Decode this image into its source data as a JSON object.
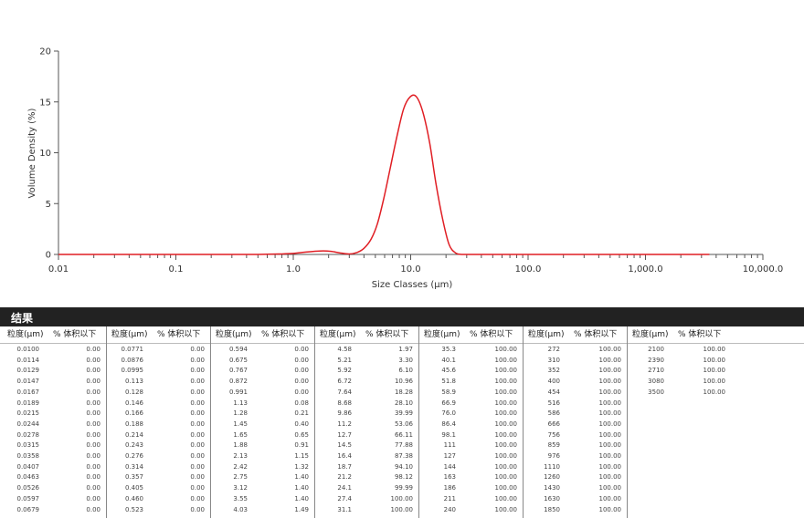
{
  "chart_data": {
    "type": "line",
    "xscale": "log",
    "xlim": [
      0.01,
      10000
    ],
    "ylim": [
      0,
      20
    ],
    "xlabel": "Size Classes (μm)",
    "ylabel": "Volume Density (%)",
    "xticks": [
      "0.01",
      "0.1",
      "1.0",
      "10.0",
      "100.0",
      "1,000.0",
      "10,000.0"
    ],
    "yticks": [
      "0",
      "5",
      "10",
      "15",
      "20"
    ],
    "color": "#e01e24",
    "series": [
      {
        "x": [
          0.01,
          0.05,
          0.2,
          0.5,
          0.8,
          1.0,
          1.2,
          1.5,
          1.8,
          2.1,
          2.5,
          3.0,
          3.5,
          4.0,
          4.6,
          5.2,
          5.9,
          6.7,
          7.6,
          8.7,
          9.9,
          11.2,
          12.7,
          14.5,
          16.4,
          18.7,
          21.2,
          24.1,
          27.4,
          31.1,
          50,
          100,
          1000,
          3500
        ],
        "y": [
          0,
          0,
          0,
          0,
          0.05,
          0.1,
          0.2,
          0.3,
          0.35,
          0.3,
          0.15,
          0.05,
          0.2,
          0.6,
          1.5,
          3.0,
          5.5,
          8.5,
          11.5,
          14.3,
          15.5,
          15.5,
          14.0,
          11.0,
          7.0,
          3.5,
          1.0,
          0.15,
          0,
          0,
          0,
          0,
          0,
          0
        ]
      }
    ]
  },
  "results": {
    "title": "结果",
    "col_size": "粒度(μm)",
    "col_vol": "% 体积以下",
    "groups": [
      {
        "sizes": [
          "0.0100",
          "0.0114",
          "0.0129",
          "0.0147",
          "0.0167",
          "0.0189",
          "0.0215",
          "0.0244",
          "0.0278",
          "0.0315",
          "0.0358",
          "0.0407",
          "0.0463",
          "0.0526",
          "0.0597",
          "0.0679"
        ],
        "vols": [
          "0.00",
          "0.00",
          "0.00",
          "0.00",
          "0.00",
          "0.00",
          "0.00",
          "0.00",
          "0.00",
          "0.00",
          "0.00",
          "0.00",
          "0.00",
          "0.00",
          "0.00",
          "0.00"
        ]
      },
      {
        "sizes": [
          "0.0771",
          "0.0876",
          "0.0995",
          "0.113",
          "0.128",
          "0.146",
          "0.166",
          "0.188",
          "0.214",
          "0.243",
          "0.276",
          "0.314",
          "0.357",
          "0.405",
          "0.460",
          "0.523"
        ],
        "vols": [
          "0.00",
          "0.00",
          "0.00",
          "0.00",
          "0.00",
          "0.00",
          "0.00",
          "0.00",
          "0.00",
          "0.00",
          "0.00",
          "0.00",
          "0.00",
          "0.00",
          "0.00",
          "0.00"
        ]
      },
      {
        "sizes": [
          "0.594",
          "0.675",
          "0.767",
          "0.872",
          "0.991",
          "1.13",
          "1.28",
          "1.45",
          "1.65",
          "1.88",
          "2.13",
          "2.42",
          "2.75",
          "3.12",
          "3.55",
          "4.03"
        ],
        "vols": [
          "0.00",
          "0.00",
          "0.00",
          "0.00",
          "0.00",
          "0.08",
          "0.21",
          "0.40",
          "0.65",
          "0.91",
          "1.15",
          "1.32",
          "1.40",
          "1.40",
          "1.40",
          "1.49"
        ]
      },
      {
        "sizes": [
          "4.58",
          "5.21",
          "5.92",
          "6.72",
          "7.64",
          "8.68",
          "9.86",
          "11.2",
          "12.7",
          "14.5",
          "16.4",
          "18.7",
          "21.2",
          "24.1",
          "27.4",
          "31.1"
        ],
        "vols": [
          "1.97",
          "3.30",
          "6.10",
          "10.96",
          "18.28",
          "28.10",
          "39.99",
          "53.06",
          "66.11",
          "77.88",
          "87.38",
          "94.10",
          "98.12",
          "99.99",
          "100.00",
          "100.00"
        ]
      },
      {
        "sizes": [
          "35.3",
          "40.1",
          "45.6",
          "51.8",
          "58.9",
          "66.9",
          "76.0",
          "86.4",
          "98.1",
          "111",
          "127",
          "144",
          "163",
          "186",
          "211",
          "240"
        ],
        "vols": [
          "100.00",
          "100.00",
          "100.00",
          "100.00",
          "100.00",
          "100.00",
          "100.00",
          "100.00",
          "100.00",
          "100.00",
          "100.00",
          "100.00",
          "100.00",
          "100.00",
          "100.00",
          "100.00"
        ]
      },
      {
        "sizes": [
          "272",
          "310",
          "352",
          "400",
          "454",
          "516",
          "586",
          "666",
          "756",
          "859",
          "976",
          "1110",
          "1260",
          "1430",
          "1630",
          "1850"
        ],
        "vols": [
          "100.00",
          "100.00",
          "100.00",
          "100.00",
          "100.00",
          "100.00",
          "100.00",
          "100.00",
          "100.00",
          "100.00",
          "100.00",
          "100.00",
          "100.00",
          "100.00",
          "100.00",
          "100.00"
        ]
      },
      {
        "sizes": [
          "2100",
          "2390",
          "2710",
          "3080",
          "3500"
        ],
        "vols": [
          "100.00",
          "100.00",
          "100.00",
          "100.00",
          "100.00"
        ]
      }
    ]
  }
}
